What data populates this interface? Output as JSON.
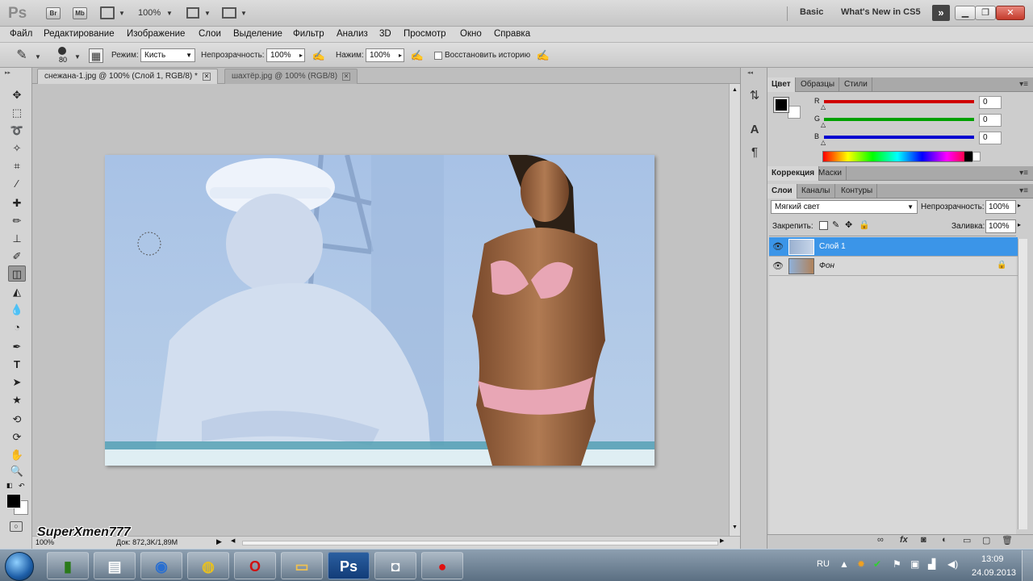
{
  "app": {
    "logo": "Ps",
    "bridge_label": "Br",
    "minibridge_label": "Mb",
    "zoom": "100%",
    "workspace_basic": "Basic",
    "workspace_new": "What's New in CS5"
  },
  "menu": [
    "Файл",
    "Редактирование",
    "Изображение",
    "Слои",
    "Выделение",
    "Фильтр",
    "Анализ",
    "3D",
    "Просмотр",
    "Окно",
    "Справка"
  ],
  "options": {
    "brush_size": "80",
    "mode_label": "Режим:",
    "mode_value": "Кисть",
    "opacity_label": "Непрозрачность:",
    "opacity_value": "100%",
    "flow_label": "Нажим:",
    "flow_value": "100%",
    "history_label": "Восстановить историю"
  },
  "tabs": [
    {
      "label": "снежана-1.jpg @ 100% (Слой 1, RGB/8) *",
      "active": true
    },
    {
      "label": "шахтёр.jpg @ 100% (RGB/8)",
      "active": false
    }
  ],
  "status": {
    "zoom": "100%",
    "doc_size": "Док: 872,3K/1,89M"
  },
  "watermark": "SuperXmen777",
  "color_panel": {
    "tabs": [
      "Цвет",
      "Образцы",
      "Стили"
    ],
    "r_label": "R",
    "g_label": "G",
    "b_label": "B",
    "r_value": "0",
    "g_value": "0",
    "b_value": "0",
    "accent_r": "#d00000",
    "accent_g": "#00a000",
    "accent_b": "#0000d0"
  },
  "adjust_panel": {
    "tabs": [
      "Коррекция",
      "Маски"
    ]
  },
  "layers_panel": {
    "tabs": [
      "Слои",
      "Каналы",
      "Контуры"
    ],
    "blend_mode": "Мягкий свет",
    "opacity_label": "Непрозрачность:",
    "opacity_value": "100%",
    "lock_label": "Закрепить:",
    "fill_label": "Заливка:",
    "fill_value": "100%",
    "layers": [
      {
        "name": "Слой 1",
        "selected": true
      },
      {
        "name": "Фон",
        "selected": false
      }
    ],
    "selection_color": "#3b95e8"
  },
  "taskbar": {
    "lang": "RU",
    "time": "13:09",
    "date": "24.09.2013"
  }
}
